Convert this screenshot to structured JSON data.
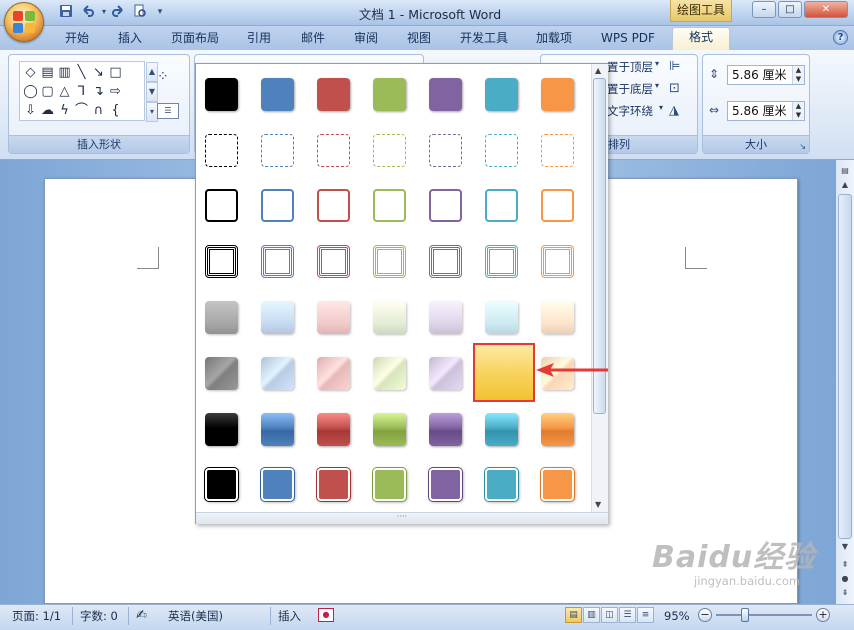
{
  "window": {
    "title": "文档 1 - Microsoft Word",
    "tool_tab_title": "绘图工具",
    "controls": {
      "minimize": "–",
      "maximize": "□",
      "close": "✕"
    }
  },
  "quick_access": {
    "icons": [
      "save-icon",
      "undo-icon",
      "redo-icon",
      "print-preview-icon",
      "customize-icon"
    ]
  },
  "tabs": [
    {
      "label": "开始"
    },
    {
      "label": "插入"
    },
    {
      "label": "页面布局"
    },
    {
      "label": "引用"
    },
    {
      "label": "邮件"
    },
    {
      "label": "审阅"
    },
    {
      "label": "视图"
    },
    {
      "label": "开发工具"
    },
    {
      "label": "加载项"
    },
    {
      "label": "WPS PDF"
    },
    {
      "label": "格式",
      "active": true
    }
  ],
  "ribbon": {
    "insert_shapes": {
      "label": "插入形状"
    },
    "arrange": {
      "label": "排列",
      "bring_to_front": "置于顶层",
      "send_to_back": "置于底层",
      "text_wrap": "文字环绕"
    },
    "size": {
      "label": "大小",
      "height_value": "5.86 厘米",
      "width_value": "5.86 厘米"
    }
  },
  "gallery": {
    "rows": [
      {
        "style": "solid-dark",
        "colors": [
          "#000000",
          "#4f81bd",
          "#c0504d",
          "#9bbb59",
          "#8064a2",
          "#4bacc6",
          "#f79646"
        ]
      },
      {
        "style": "dashed-outline",
        "colors": [
          "#000000",
          "#4f81bd",
          "#c0504d",
          "#9bbb59",
          "#8064a2",
          "#4bacc6",
          "#f79646"
        ]
      },
      {
        "style": "outline",
        "colors": [
          "#000000",
          "#4f81bd",
          "#c0504d",
          "#9bbb59",
          "#8064a2",
          "#4bacc6",
          "#f79646"
        ]
      },
      {
        "style": "double-outline",
        "colors": [
          "#000000",
          "#4f81bd",
          "#c0504d",
          "#9bbb59",
          "#8064a2",
          "#4bacc6",
          "#f79646"
        ]
      },
      {
        "style": "light-gradient",
        "colors": [
          "#a6a6a6",
          "#c6d9f1",
          "#f2c9c8",
          "#e2ecd4",
          "#ddd4e8",
          "#cde9f1",
          "#fde2cc"
        ]
      },
      {
        "style": "diagonal-gradient",
        "colors": [
          "#7f7f7f",
          "#b8cce4",
          "#e6b9b8",
          "#d7e4bd",
          "#ccc1da",
          "#b7dde8",
          "#fbd5b5"
        ]
      },
      {
        "style": "intense-gradient",
        "colors": [
          "#000000",
          "#4f81bd",
          "#c0504d",
          "#9bbb59",
          "#8064a2",
          "#4bacc6",
          "#f79646"
        ]
      },
      {
        "style": "solid-framed",
        "colors": [
          "#000000",
          "#4f81bd",
          "#c0504d",
          "#9bbb59",
          "#8064a2",
          "#4bacc6",
          "#f79646"
        ]
      }
    ],
    "selected": {
      "row": 5,
      "col": 5
    },
    "highlight_color": "#e53935"
  },
  "statusbar": {
    "page": "页面: 1/1",
    "words": "字数: 0",
    "language": "英语(美国)",
    "mode": "插入",
    "zoom": "95%",
    "zoom_fraction": 0.3
  },
  "watermark": {
    "main": "Baidu经验",
    "sub": "jingyan.baidu.com"
  }
}
